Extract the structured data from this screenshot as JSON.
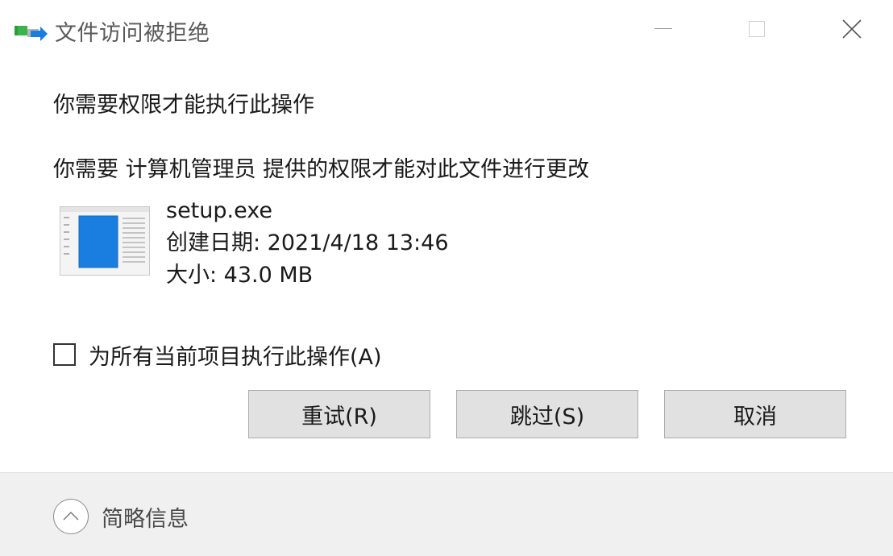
{
  "window": {
    "title": "文件访问被拒绝",
    "icon": "file-move-icon",
    "controls": {
      "minimize": "minimize-icon",
      "maximize": "maximize-icon",
      "close": "close-icon"
    }
  },
  "dialog": {
    "heading": "你需要权限才能执行此操作",
    "message": "你需要 计算机管理员 提供的权限才能对此文件进行更改"
  },
  "file": {
    "icon": "exe-file-icon",
    "name": "setup.exe",
    "created": "创建日期: 2021/4/18 13:46",
    "size": "大小: 43.0 MB"
  },
  "checkbox": {
    "label": "为所有当前项目执行此操作(A)",
    "checked": false
  },
  "buttons": {
    "retry": "重试(R)",
    "skip": "跳过(S)",
    "cancel": "取消"
  },
  "footer": {
    "details_label": "简略信息",
    "details_icon": "chevron-up-icon"
  },
  "colors": {
    "button_bg": "#e1e1e1",
    "button_border": "#adadad",
    "footer_bg": "#f0f0f0",
    "accent_blue": "#1a7ee0",
    "icon_green": "#2e9a3a"
  }
}
